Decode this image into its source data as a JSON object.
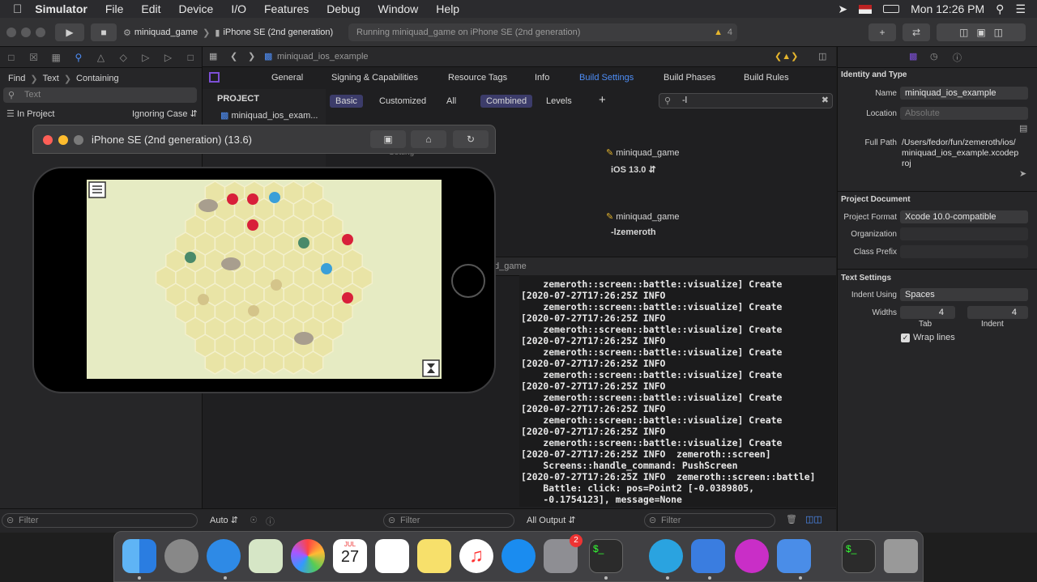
{
  "menubar": {
    "app": "Simulator",
    "items": [
      "File",
      "Edit",
      "Device",
      "I/O",
      "Features",
      "Debug",
      "Window",
      "Help"
    ],
    "clock": "Mon 12:26 PM"
  },
  "toolbar": {
    "scheme": "miniquad_game",
    "device": "iPhone SE (2nd generation)",
    "status": "Running miniquad_game on iPhone SE (2nd generation)",
    "warnings": "4"
  },
  "navigator": {
    "find": "Find",
    "text": "Text",
    "containing": "Containing",
    "search_placeholder": "Text",
    "scope": "In Project",
    "case": "Ignoring Case",
    "filter_placeholder": "Filter"
  },
  "editor": {
    "breadcrumb": "miniquad_ios_example",
    "tabs": [
      "General",
      "Signing & Capabilities",
      "Resource Tags",
      "Info",
      "Build Settings",
      "Build Phases",
      "Build Rules"
    ],
    "active_tab": "Build Settings",
    "project_header": "PROJECT",
    "project_item": "miniquad_ios_exam...",
    "filters": [
      "Basic",
      "Customized",
      "All",
      "Combined",
      "Levels"
    ],
    "search_value": "-l",
    "rows": [
      {
        "target": "miniquad_game",
        "value": "iOS 13.0"
      },
      {
        "target": "miniquad_game",
        "value": "-lzemeroth"
      }
    ],
    "partial_setting": "Setting",
    "console_header": "d_game",
    "auto_label": "Auto",
    "output_label": "All Output",
    "filter_placeholder": "Filter"
  },
  "console_lines": [
    "    zemeroth::screen::battle::visualize] Create",
    "[2020-07-27T17:26:25Z INFO",
    "    zemeroth::screen::battle::visualize] Create",
    "[2020-07-27T17:26:25Z INFO",
    "    zemeroth::screen::battle::visualize] Create",
    "[2020-07-27T17:26:25Z INFO",
    "    zemeroth::screen::battle::visualize] Create",
    "[2020-07-27T17:26:25Z INFO",
    "    zemeroth::screen::battle::visualize] Create",
    "[2020-07-27T17:26:25Z INFO",
    "    zemeroth::screen::battle::visualize] Create",
    "[2020-07-27T17:26:25Z INFO",
    "    zemeroth::screen::battle::visualize] Create",
    "[2020-07-27T17:26:25Z INFO",
    "    zemeroth::screen::battle::visualize] Create",
    "[2020-07-27T17:26:25Z INFO  zemeroth::screen]",
    "    Screens::handle_command: PushScreen",
    "[2020-07-27T17:26:25Z INFO  zemeroth::screen::battle]",
    "    Battle: click: pos=Point2 [-0.0389805,",
    "    -0.1754123], message=None"
  ],
  "inspector": {
    "identity_title": "Identity and Type",
    "name_label": "Name",
    "name_value": "miniquad_ios_example",
    "location_label": "Location",
    "location_value": "Absolute",
    "fullpath_label": "Full Path",
    "fullpath_value": "/Users/fedor/fun/zemeroth/ios/miniquad_ios_example.xcodeproj",
    "project_doc_title": "Project Document",
    "format_label": "Project Format",
    "format_value": "Xcode 10.0-compatible",
    "org_label": "Organization",
    "prefix_label": "Class Prefix",
    "text_settings_title": "Text Settings",
    "indent_label": "Indent Using",
    "indent_value": "Spaces",
    "widths_label": "Widths",
    "tab_value": "4",
    "indent_width_value": "4",
    "tab_label": "Tab",
    "indent_sub_label": "Indent",
    "wrap_label": "Wrap lines"
  },
  "simulator": {
    "title": "iPhone SE (2nd generation) (13.6)"
  },
  "dock": {
    "calendar_month": "JUL",
    "calendar_day": "27",
    "badge": "2"
  },
  "colors": {
    "accent": "#4e8ef7",
    "warning": "#e5b52d",
    "board": "#e6ebc3"
  }
}
